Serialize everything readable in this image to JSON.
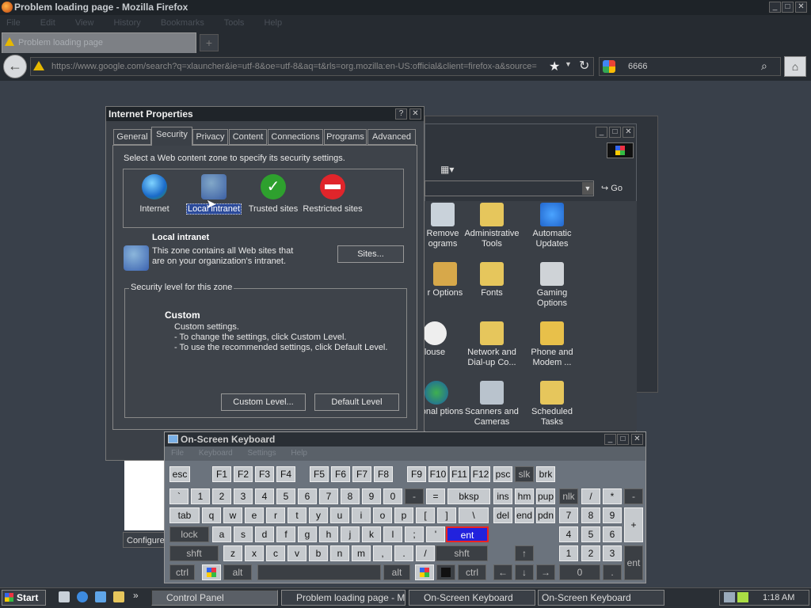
{
  "firefox": {
    "title": "Problem loading page - Mozilla Firefox",
    "menu": [
      "File",
      "Edit",
      "View",
      "History",
      "Bookmarks",
      "Tools",
      "Help"
    ],
    "tab_title": "Problem loading page",
    "new_tab": "+",
    "url": "https://www.google.com/search?q=xlauncher&ie=utf-8&oe=utf-8&aq=t&rls=org.mozilla:en-US:official&client=firefox-a&source=",
    "search_value": "6666",
    "bookmark_star": "★",
    "reload": "↻"
  },
  "control_panel": {
    "go_label": "Go",
    "items": [
      {
        "label": "Remove\nograms",
        "icon": "add-remove-programs-icon"
      },
      {
        "label": "Administrative Tools",
        "icon": "administrative-tools-icon"
      },
      {
        "label": "Automatic Updates",
        "icon": "automatic-updates-icon"
      },
      {
        "label": "r Options",
        "icon": "folder-options-icon"
      },
      {
        "label": "Fonts",
        "icon": "fonts-icon"
      },
      {
        "label": "Gaming Options",
        "icon": "gaming-options-icon"
      },
      {
        "label": "louse",
        "icon": "mouse-icon"
      },
      {
        "label": "Network and Dial-up Co...",
        "icon": "network-icon"
      },
      {
        "label": "Phone and Modem ...",
        "icon": "phone-modem-icon"
      },
      {
        "label": "egional ptions",
        "icon": "regional-options-icon"
      },
      {
        "label": "Scanners and Cameras",
        "icon": "scanners-icon"
      },
      {
        "label": "Scheduled Tasks",
        "icon": "scheduled-tasks-icon"
      }
    ],
    "configure": "Configure"
  },
  "internet_properties": {
    "title": "Internet Properties",
    "help": "?",
    "close": "✕",
    "tabs": [
      "General",
      "Security",
      "Privacy",
      "Content",
      "Connections",
      "Programs",
      "Advanced"
    ],
    "zone_prompt": "Select a Web content zone to specify its security settings.",
    "zones": [
      {
        "label": "Internet"
      },
      {
        "label": "Local intranet"
      },
      {
        "label": "Trusted sites"
      },
      {
        "label": "Restricted sites"
      }
    ],
    "zone_name": "Local intranet",
    "zone_desc": "This zone contains all Web sites that are on your organization's intranet.",
    "sites_button": "Sites...",
    "security_group": "Security level for this zone",
    "level_name": "Custom",
    "level_lines": [
      "Custom settings.",
      "- To change the settings, click Custom Level.",
      "- To use the recommended settings, click Default Level."
    ],
    "custom_level_button": "Custom Level...",
    "default_level_button": "Default Level"
  },
  "osk": {
    "title": "On-Screen Keyboard",
    "menu": [
      "File",
      "Keyboard",
      "Settings",
      "Help"
    ],
    "row1": [
      "esc",
      "F1",
      "F2",
      "F3",
      "F4",
      "F5",
      "F6",
      "F7",
      "F8",
      "F9",
      "F10",
      "F11",
      "F12",
      "psc",
      "slk",
      "brk"
    ],
    "row2": [
      "`",
      "1",
      "2",
      "3",
      "4",
      "5",
      "6",
      "7",
      "8",
      "9",
      "0",
      "-",
      "=",
      "bksp",
      "ins",
      "hm",
      "pup",
      "nlk",
      "/",
      "*",
      "-"
    ],
    "row3": [
      "tab",
      "q",
      "w",
      "e",
      "r",
      "t",
      "y",
      "u",
      "i",
      "o",
      "p",
      "[",
      "]",
      "\\",
      "del",
      "end",
      "pdn",
      "7",
      "8",
      "9",
      "+"
    ],
    "row4": [
      "lock",
      "a",
      "s",
      "d",
      "f",
      "g",
      "h",
      "j",
      "k",
      "l",
      ";",
      "'",
      "ent",
      "4",
      "5",
      "6"
    ],
    "row5": [
      "shft",
      "z",
      "x",
      "c",
      "v",
      "b",
      "n",
      "m",
      ",",
      ".",
      "/",
      "shft",
      "↑",
      "1",
      "2",
      "3"
    ],
    "row6": [
      "ctrl",
      "alt",
      "alt",
      "ctrl",
      "←",
      "↓",
      "→",
      "0",
      ".",
      "ent"
    ]
  },
  "taskbar": {
    "start": "Start",
    "items": [
      "Control Panel",
      "Problem loading page - M...",
      "On-Screen Keyboard",
      "On-Screen Keyboard"
    ],
    "clock": "1:18 AM"
  }
}
